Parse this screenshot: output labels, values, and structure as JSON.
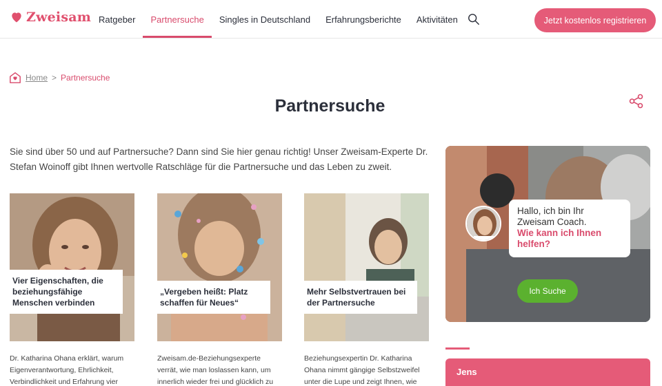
{
  "header": {
    "logo_text": "Zweisam",
    "nav": [
      {
        "label": "Ratgeber"
      },
      {
        "label": "Partnersuche"
      },
      {
        "label": "Singles in Deutschland"
      },
      {
        "label": "Erfahrungsberichte"
      },
      {
        "label": "Aktivitäten"
      }
    ],
    "active_nav": "Partnersuche",
    "register_label": "Jetzt kostenlos registrieren",
    "search_icon": "search-icon"
  },
  "breadcrumb": {
    "home": "Home",
    "separator": ">",
    "current": "Partnersuche"
  },
  "page": {
    "title": "Partnersuche",
    "intro": "Sie sind über 50 und auf Partnersuche? Dann sind Sie hier genau richtig! Unser Zweisam-Experte Dr. Stefan Woinoff gibt Ihnen wertvolle Ratschläge für die Partnersuche und das Leben zu zweit."
  },
  "cards": [
    {
      "title": "Vier Eigenschaften, die beziehungsfähige Menschen verbinden",
      "desc": "Dr. Katharina Ohana erklärt, warum Eigenverantwortung, Ehrlichkeit, Verbindlichkeit und Erfahrung vier"
    },
    {
      "title": "„Vergeben heißt: Platz schaffen für Neues“",
      "desc": "Zweisam.de-Beziehungsexperte verrät, wie man loslassen kann, um innerlich wieder frei und glücklich zu werden"
    },
    {
      "title": "Mehr Selbstvertrauen bei der Partnersuche",
      "desc": "Beziehungsexpertin Dr. Katharina Ohana nimmt gängige Selbstzweifel unter die Lupe und zeigt Ihnen, wie Sie"
    }
  ],
  "coach": {
    "greeting": "Hallo, ich bin Ihr Zweisam Coach.",
    "question": "Wie kann ich Ihnen helfen?",
    "button": "Ich Suche"
  },
  "sidebar": {
    "item": "Jens"
  },
  "colors": {
    "brand": "#e55b78",
    "active": "#d94b6c",
    "cta_green": "#5bb12f"
  }
}
